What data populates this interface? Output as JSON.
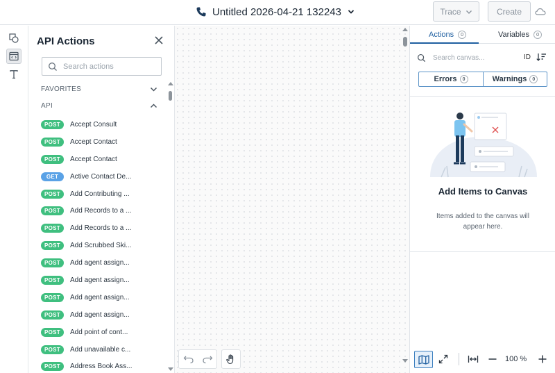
{
  "header": {
    "title": "Untitled 2026-04-21 132243",
    "trace_label": "Trace",
    "create_label": "Create"
  },
  "actions_panel": {
    "title": "API Actions",
    "search_placeholder": "Search actions",
    "sections": {
      "favorites": "FAVORITES",
      "api": "API"
    },
    "items": [
      {
        "method": "POST",
        "label": "Accept Consult"
      },
      {
        "method": "POST",
        "label": "Accept Contact"
      },
      {
        "method": "POST",
        "label": "Accept Contact"
      },
      {
        "method": "GET",
        "label": "Active Contact De..."
      },
      {
        "method": "POST",
        "label": "Add Contributing ..."
      },
      {
        "method": "POST",
        "label": "Add Records to a ..."
      },
      {
        "method": "POST",
        "label": "Add Records to a ..."
      },
      {
        "method": "POST",
        "label": "Add Scrubbed Ski..."
      },
      {
        "method": "POST",
        "label": "Add agent assign..."
      },
      {
        "method": "POST",
        "label": "Add agent assign..."
      },
      {
        "method": "POST",
        "label": "Add agent assign..."
      },
      {
        "method": "POST",
        "label": "Add agent assign..."
      },
      {
        "method": "POST",
        "label": "Add point of cont..."
      },
      {
        "method": "POST",
        "label": "Add unavailable c..."
      },
      {
        "method": "POST",
        "label": "Address Book Ass..."
      }
    ]
  },
  "right_panel": {
    "tabs": [
      {
        "label": "Actions",
        "count": "0"
      },
      {
        "label": "Variables",
        "count": "0"
      }
    ],
    "search_placeholder": "Search canvas...",
    "id_label": "ID",
    "errors": {
      "label": "Errors",
      "count": "0"
    },
    "warnings": {
      "label": "Warnings",
      "count": "0"
    },
    "empty_title": "Add Items to Canvas",
    "empty_desc": "Items added to the canvas will appear here."
  },
  "toolbar": {
    "zoom": "100 %"
  },
  "colors": {
    "post": "#3fbf7f",
    "get": "#5aa2e6",
    "accent": "#1f5fa0"
  }
}
